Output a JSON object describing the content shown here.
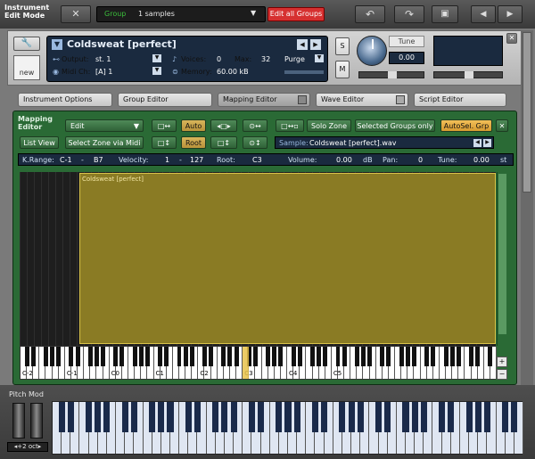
{
  "app": {
    "mode_label_line1": "Instrument",
    "mode_label_line2": "Edit Mode"
  },
  "toolbar": {
    "group_label": "Group",
    "samples_label": "1 samples",
    "edit_all_label": "Edit all Groups"
  },
  "instrument": {
    "name": "Coldsweat [perfect]",
    "output_label": "Output:",
    "output_value": "st. 1",
    "voices_label": "Voices:",
    "voices_value": "0",
    "max_label": "Max:",
    "max_value": "32",
    "purge_label": "Purge",
    "midi_label": "Midi Ch:",
    "midi_value": "[A]  1",
    "memory_label": "Memory:",
    "memory_value": "60.00 kB",
    "tune_label": "Tune",
    "tune_value": "0.00",
    "s_label": "S",
    "m_label": "M",
    "new_label": "new"
  },
  "tabs": [
    {
      "label": "Instrument Options"
    },
    {
      "label": "Group Editor"
    },
    {
      "label": "Mapping Editor"
    },
    {
      "label": "Wave Editor"
    },
    {
      "label": "Script Editor"
    }
  ],
  "mapping": {
    "title_line1": "Mapping",
    "title_line2": "Editor",
    "edit_label": "Edit",
    "list_view_label": "List View",
    "select_zone_label": "Select Zone via Midi",
    "auto_label": "Auto",
    "root_btn_label": "Root",
    "solo_zone_label": "Solo Zone",
    "selected_groups_label": "Selected Groups only",
    "autosel_label": "AutoSel. Grp",
    "sample_label": "Sample:",
    "sample_value": "Coldsweat [perfect].wav",
    "krange_label": "K.Range:",
    "krange_lo": "C-1",
    "krange_dash": "-",
    "krange_hi": "B7",
    "velocity_label": "Velocity:",
    "vel_lo": "1",
    "vel_dash": "-",
    "vel_hi": "127",
    "root_label": "Root:",
    "root_value": "C3",
    "volume_label": "Volume:",
    "volume_value": "0.00",
    "volume_unit": "dB",
    "pan_label": "Pan:",
    "pan_value": "0",
    "tune_label": "Tune:",
    "tune_value": "0.00",
    "tune_unit": "st",
    "zone_name": "Coldsweat [perfect]",
    "octave_labels": [
      "C-2",
      "C-1",
      "C0",
      "C1",
      "C2",
      "C3",
      "C4",
      "C5"
    ]
  },
  "bottom": {
    "pitch_mod_label": "Pitch Mod",
    "octave_label": "+2 oct"
  },
  "colors": {
    "zone": "#8a7b24",
    "zone_border": "#d8c24a",
    "accent_red": "#d63030",
    "autosel": "#e8a640",
    "panel_navy": "#1a2a3f",
    "editor_green": "#2a6a35"
  }
}
